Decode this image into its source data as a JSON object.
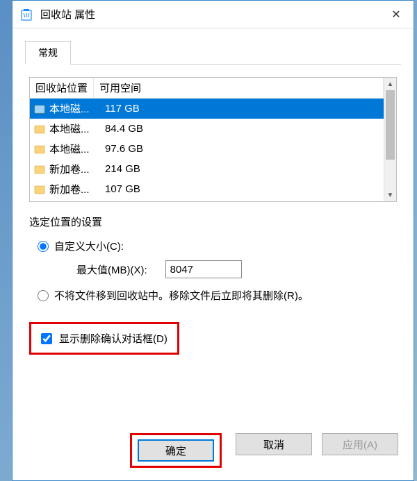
{
  "window": {
    "title": "回收站 属性"
  },
  "tabs": {
    "general": "常规"
  },
  "list": {
    "header": {
      "location": "回收站位置",
      "space": "可用空间"
    },
    "rows": [
      {
        "name": "本地磁...",
        "space": "117 GB",
        "selected": true,
        "icon": "disk"
      },
      {
        "name": "本地磁...",
        "space": "84.4 GB",
        "selected": false,
        "icon": "folder"
      },
      {
        "name": "本地磁...",
        "space": "97.6 GB",
        "selected": false,
        "icon": "folder"
      },
      {
        "name": "新加卷...",
        "space": "214 GB",
        "selected": false,
        "icon": "folder"
      },
      {
        "name": "新加卷...",
        "space": "107 GB",
        "selected": false,
        "icon": "folder"
      }
    ]
  },
  "settings": {
    "title": "选定位置的设置",
    "custom_size": "自定义大小(C):",
    "max_size_label": "最大值(MB)(X):",
    "max_size_value": "8047",
    "dont_move": "不将文件移到回收站中。移除文件后立即将其删除(R)。",
    "confirm_delete": "显示删除确认对话框(D)"
  },
  "buttons": {
    "ok": "确定",
    "cancel": "取消",
    "apply": "应用(A)"
  }
}
